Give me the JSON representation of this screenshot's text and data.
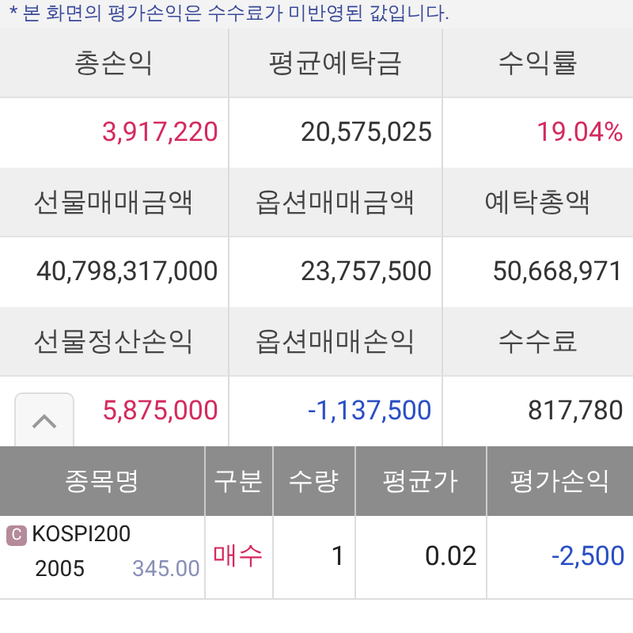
{
  "notice": "* 본 화면의 평가손익은 수수료가 미반영된 값입니다.",
  "summary": [
    {
      "label": "총손익",
      "value": "3,917,220",
      "color": "#d42a5e"
    },
    {
      "label": "평균예탁금",
      "value": "20,575,025",
      "color": "#333333"
    },
    {
      "label": "수익률",
      "value": "19.04%",
      "color": "#d42a5e"
    },
    {
      "label": "선물매매금액",
      "value": "40,798,317,000",
      "color": "#333333"
    },
    {
      "label": "옵션매매금액",
      "value": "23,757,500",
      "color": "#333333"
    },
    {
      "label": "예탁총액",
      "value": "50,668,971",
      "color": "#333333"
    },
    {
      "label": "선물정산손익",
      "value": "5,875,000",
      "color": "#d42a5e"
    },
    {
      "label": "옵션매매손익",
      "value": "-1,137,500",
      "color": "#2a4fc4"
    },
    {
      "label": "수수료",
      "value": "817,780",
      "color": "#333333"
    }
  ],
  "collapse_button": {
    "expanded": true
  },
  "table": {
    "columns": [
      "종목명",
      "구분",
      "수량",
      "평균가",
      "평가손익"
    ],
    "rows": [
      {
        "badge": "C",
        "name": "KOSPI200",
        "month": "2005",
        "strike": "345.00",
        "side": {
          "text": "매수",
          "color": "#d42a5e"
        },
        "qty": "1",
        "avg": "0.02",
        "pnl": {
          "text": "-2,500",
          "color": "#2a4fc4"
        }
      }
    ]
  }
}
